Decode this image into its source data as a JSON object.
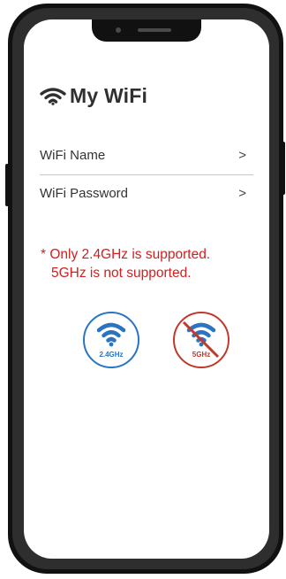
{
  "app": {
    "title": "My WiFi"
  },
  "rows": [
    {
      "label": "WiFi Name",
      "chevron": ">"
    },
    {
      "label": "WiFi Password",
      "chevron": ">"
    }
  ],
  "notice": {
    "line1": "* Only 2.4GHz is supported.",
    "line2": "5GHz is not supported."
  },
  "bands": [
    {
      "label": "2.4GHz",
      "supported": true,
      "color": "#2a74c2",
      "icon": "wifi-icon"
    },
    {
      "label": "5GHz",
      "supported": false,
      "color": "#c0392b",
      "icon": "wifi-disabled-icon"
    }
  ],
  "colors": {
    "title": "#303030",
    "warning": "#d02020",
    "divider": "#c8c8c8"
  }
}
